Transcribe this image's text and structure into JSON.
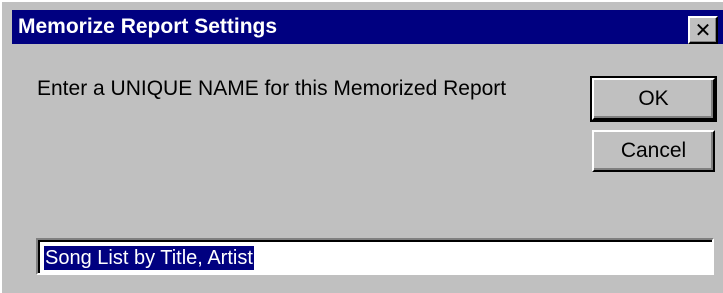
{
  "window": {
    "title": "Memorize Report Settings",
    "close_glyph": "✕",
    "close_icon": "close-icon",
    "colors": {
      "titlebar": "#000080",
      "face": "#c0c0c0",
      "selection": "#000080"
    }
  },
  "dialog": {
    "prompt": "Enter a UNIQUE NAME for this Memorized Report",
    "name_value": "Song List by Title, Artist",
    "ok_label": "OK",
    "cancel_label": "Cancel"
  }
}
